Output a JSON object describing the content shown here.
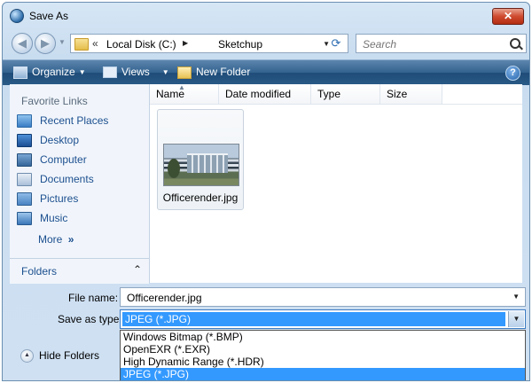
{
  "window": {
    "title": "Save As",
    "close_label": "✕"
  },
  "address": {
    "segments": [
      "Local Disk (C:)",
      "Sketchup"
    ]
  },
  "search": {
    "placeholder": "Search"
  },
  "toolbar": {
    "organize": "Organize",
    "views": "Views",
    "new_folder": "New Folder",
    "help": "?"
  },
  "sidebar": {
    "header": "Favorite Links",
    "items": [
      {
        "label": "Recent Places",
        "icon": "recent-places-icon"
      },
      {
        "label": "Desktop",
        "icon": "desktop-icon"
      },
      {
        "label": "Computer",
        "icon": "computer-icon"
      },
      {
        "label": "Documents",
        "icon": "documents-icon"
      },
      {
        "label": "Pictures",
        "icon": "pictures-icon"
      },
      {
        "label": "Music",
        "icon": "music-icon"
      }
    ],
    "more": "More",
    "folders": "Folders"
  },
  "columns": [
    "Name",
    "Date modified",
    "Type",
    "Size"
  ],
  "files": [
    {
      "name": "Officerender.jpg"
    }
  ],
  "file_name": {
    "label": "File name:",
    "value": "Officerender.jpg"
  },
  "save_type": {
    "label": "Save as type:",
    "value": "JPEG (*.JPG)",
    "options": [
      "Windows Bitmap (*.BMP)",
      "OpenEXR (*.EXR)",
      "High Dynamic Range (*.HDR)",
      "JPEG (*.JPG)"
    ]
  },
  "hide_folders": "Hide Folders",
  "colors": {
    "accent": "#3399ff",
    "toolbar": "#2a5a87",
    "link": "#1c4f8f"
  }
}
